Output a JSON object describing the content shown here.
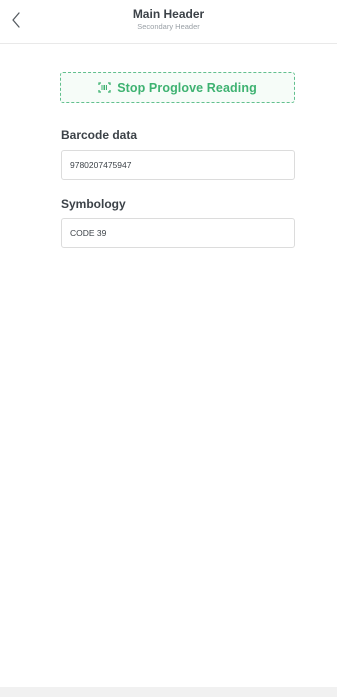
{
  "header": {
    "main_title": "Main Header",
    "secondary_title": "Secondary Header"
  },
  "scan_button": {
    "label": "Stop Proglove Reading",
    "icon": "barcode-scan-icon",
    "accent_color": "#3eb271"
  },
  "barcode": {
    "label": "Barcode data",
    "value": "9780207475947"
  },
  "symbology": {
    "label": "Symbology",
    "value": "CODE 39"
  }
}
